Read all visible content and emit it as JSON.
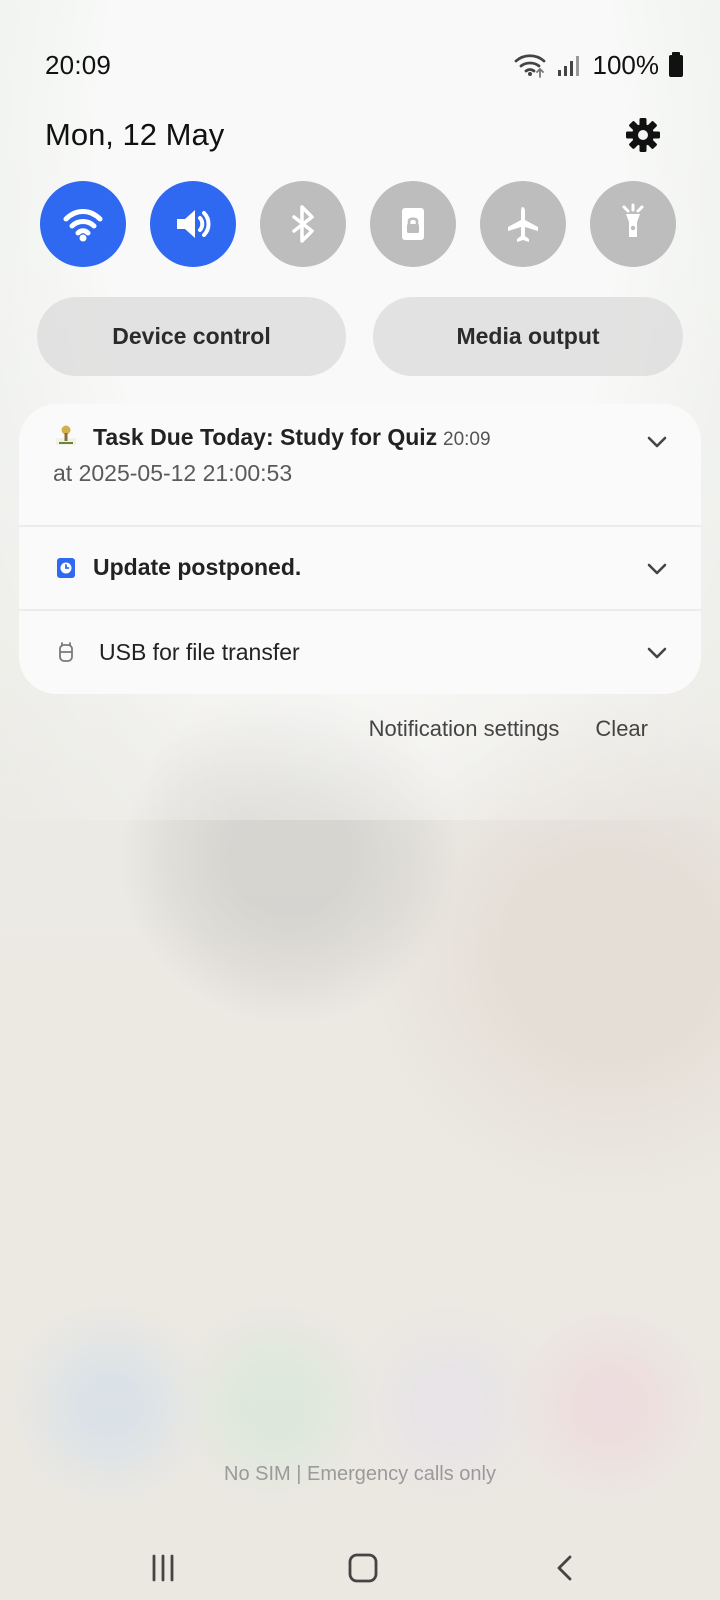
{
  "status_bar": {
    "time": "20:09",
    "battery": "100%",
    "icons": [
      "wifi-icon",
      "signal-icon",
      "battery-icon"
    ]
  },
  "header": {
    "date": "Mon, 12 May",
    "settings_icon": "gear-icon"
  },
  "quick_settings": [
    {
      "icon": "wifi-icon",
      "active": true
    },
    {
      "icon": "volume-icon",
      "active": true
    },
    {
      "icon": "bluetooth-icon",
      "active": false
    },
    {
      "icon": "rotation-lock-icon",
      "active": false
    },
    {
      "icon": "airplane-icon",
      "active": false
    },
    {
      "icon": "flashlight-icon",
      "active": false
    }
  ],
  "actions": {
    "device_control": "Device control",
    "media_output": "Media output"
  },
  "notifications": [
    {
      "icon": "task-app-icon",
      "title": "Task Due Today: Study for Quiz",
      "time": "20:09",
      "body": "at 2025-05-12 21:00:53"
    },
    {
      "icon": "system-update-icon",
      "title": "Update postponed."
    },
    {
      "icon": "usb-icon",
      "title": "USB for file transfer"
    }
  ],
  "panel_actions": {
    "notification_settings": "Notification settings",
    "clear": "Clear"
  },
  "carrier": "No SIM | Emergency calls only",
  "navigation": [
    {
      "icon": "recent-apps-icon"
    },
    {
      "icon": "home-icon"
    },
    {
      "icon": "back-icon"
    }
  ],
  "colors": {
    "accent": "#2f69f1",
    "inactive_toggle": "#bdbdbd",
    "card": "#fafafa"
  }
}
